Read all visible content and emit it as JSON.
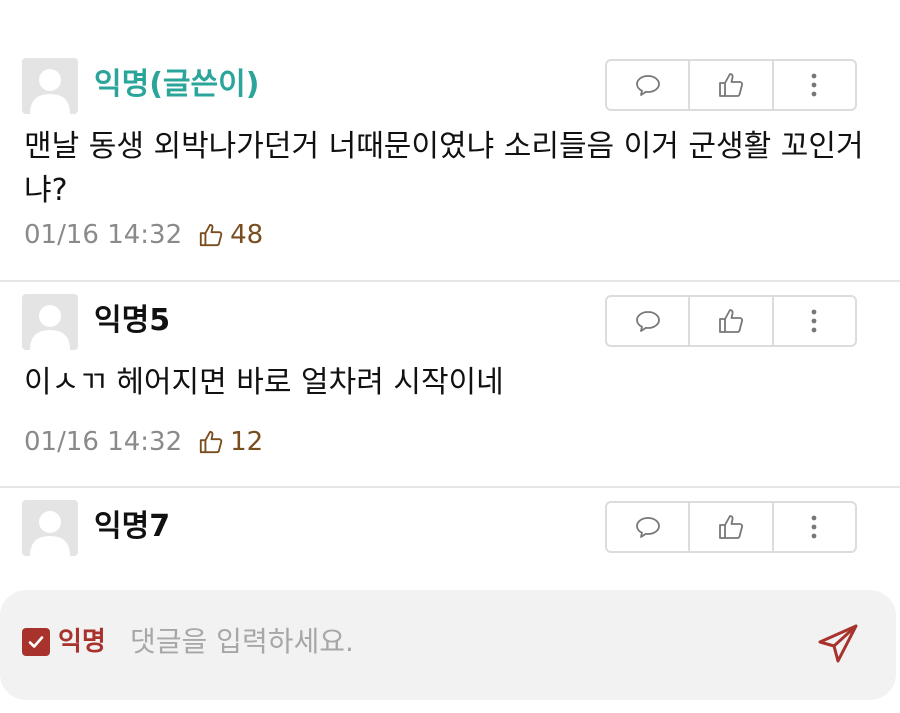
{
  "comments": [
    {
      "author": "익명(글쓴이)",
      "text": "맨날 동생 외박나가던거 너때문이였냐 소리들음 이거 군생활 꼬인거냐?",
      "timestamp": "01/16 14:32",
      "likes": "48",
      "is_op": true
    },
    {
      "author": "익명5",
      "text": "이ㅅㄲ 헤어지면 바로 얼차려 시작이네",
      "timestamp": "01/16 14:32",
      "likes": "12",
      "is_op": false
    },
    {
      "author": "익명7",
      "is_op": false
    }
  ],
  "actions": {
    "reply_icon": "speech-bubble-icon",
    "like_icon": "thumbs-up-icon",
    "more_icon": "vertical-ellipsis-icon"
  },
  "input": {
    "anonymous_label": "익명",
    "anonymous_checked": true,
    "placeholder": "댓글을 입력하세요.",
    "send_icon": "paper-plane-icon"
  },
  "colors": {
    "op_author": "#2ba59a",
    "accent": "#a8322c",
    "likes_text": "#7a4d1e"
  }
}
